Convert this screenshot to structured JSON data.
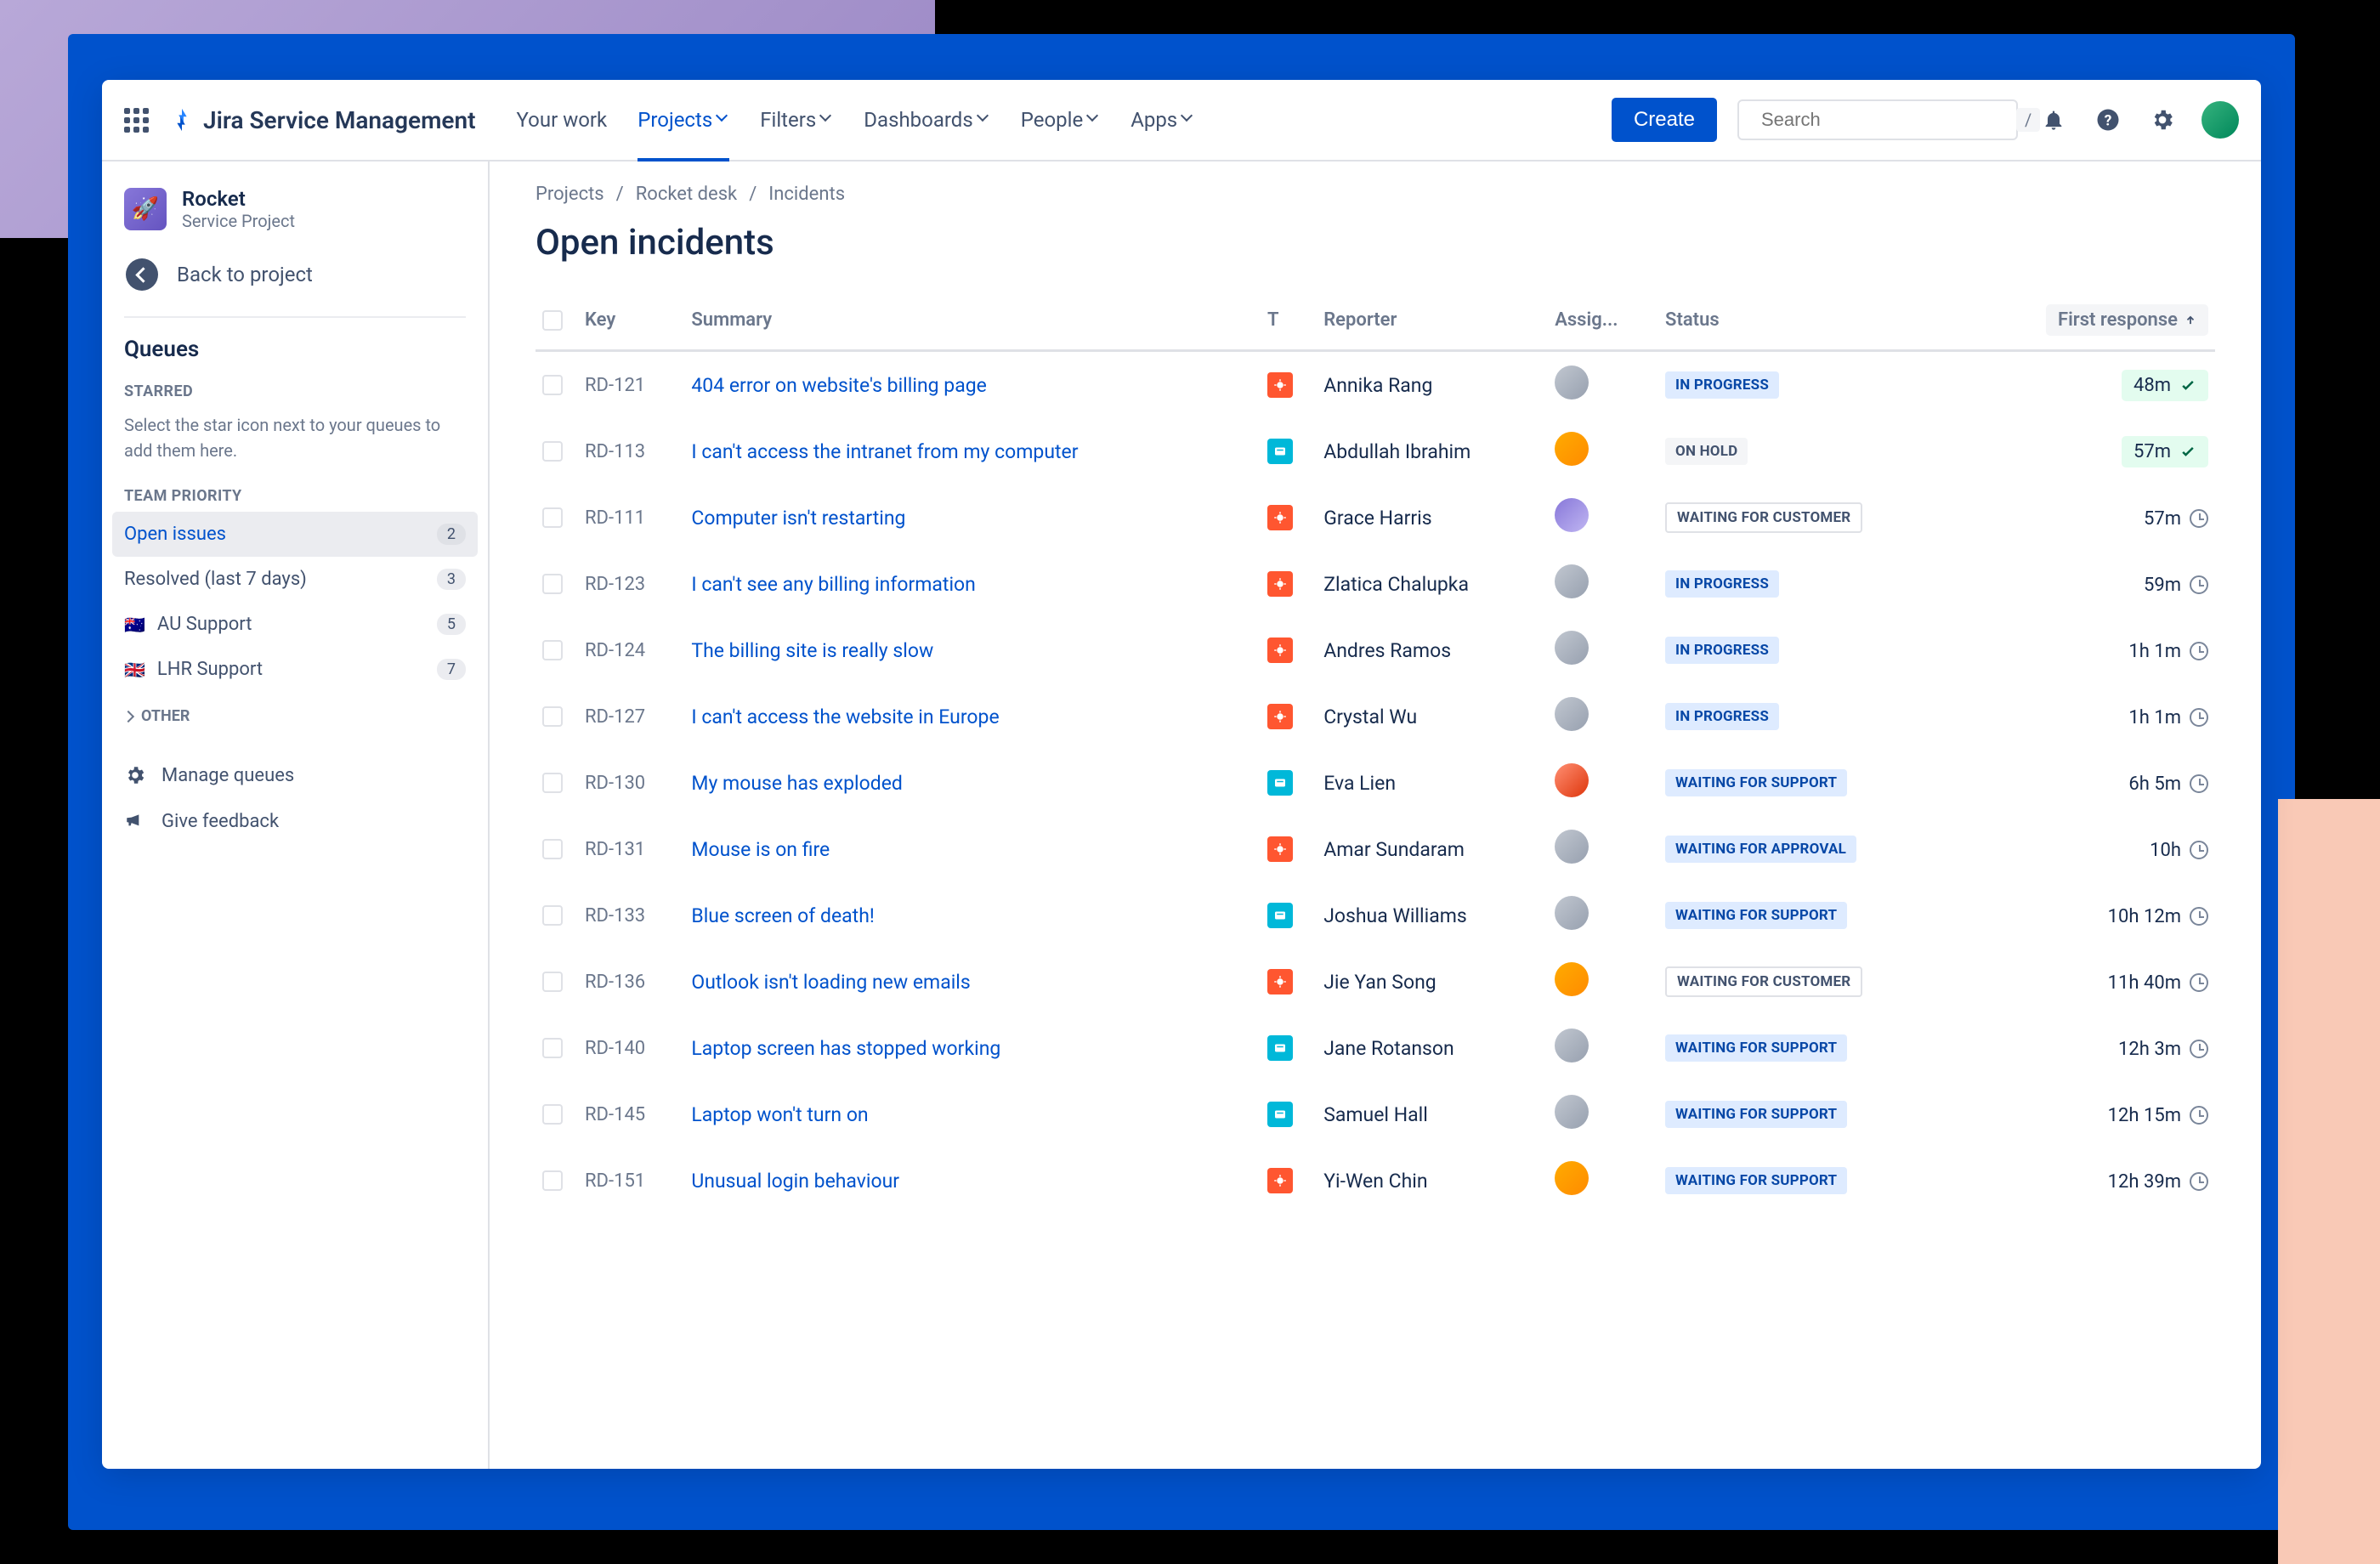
{
  "product": "Jira Service Management",
  "nav": {
    "your_work": "Your work",
    "projects": "Projects",
    "filters": "Filters",
    "dashboards": "Dashboards",
    "people": "People",
    "apps": "Apps"
  },
  "create": "Create",
  "search": {
    "placeholder": "Search",
    "kbd": "/"
  },
  "sidebar": {
    "project": {
      "name": "Rocket",
      "sub": "Service Project"
    },
    "back": "Back to project",
    "queues_title": "Queues",
    "starred": "STARRED",
    "starred_hint": "Select the star icon next to your queues to add them here.",
    "team_priority": "TEAM PRIORITY",
    "items": [
      {
        "label": "Open issues",
        "count": "2",
        "active": true
      },
      {
        "label": "Resolved (last 7 days)",
        "count": "3"
      },
      {
        "label": "AU Support",
        "count": "5",
        "flag": "🇦🇺"
      },
      {
        "label": "LHR Support",
        "count": "7",
        "flag": "🇬🇧"
      }
    ],
    "other": "OTHER",
    "manage": "Manage queues",
    "feedback": "Give feedback"
  },
  "breadcrumbs": [
    "Projects",
    "Rocket desk",
    "Incidents"
  ],
  "page_title": "Open incidents",
  "columns": {
    "key": "Key",
    "summary": "Summary",
    "type": "T",
    "reporter": "Reporter",
    "assignee": "Assig...",
    "status": "Status",
    "first_response": "First response"
  },
  "statuses": {
    "inprogress": "IN PROGRESS",
    "hold": "ON HOLD",
    "waitcust": "WAITING FOR CUSTOMER",
    "waitsup": "WAITING FOR SUPPORT",
    "waitapp": "WAITING FOR APPROVAL"
  },
  "rows": [
    {
      "key": "RD-121",
      "summary": "404 error on website's billing page",
      "type": "red",
      "reporter": "Annika Rang",
      "av": "c1",
      "status": "inprogress",
      "resp": "48m",
      "good": true
    },
    {
      "key": "RD-113",
      "summary": "I can't access the intranet from my computer",
      "type": "blue",
      "reporter": "Abdullah Ibrahim",
      "av": "c2",
      "status": "hold",
      "resp": "57m",
      "good": true
    },
    {
      "key": "RD-111",
      "summary": "Computer isn't restarting",
      "type": "red",
      "reporter": "Grace Harris",
      "av": "c3",
      "status": "waitcust",
      "resp": "57m"
    },
    {
      "key": "RD-123",
      "summary": "I can't see any billing information",
      "type": "red",
      "reporter": "Zlatica Chalupka",
      "av": "c1",
      "status": "inprogress",
      "resp": "59m"
    },
    {
      "key": "RD-124",
      "summary": "The billing site is really slow",
      "type": "red",
      "reporter": "Andres Ramos",
      "av": "c1",
      "status": "inprogress",
      "resp": "1h 1m"
    },
    {
      "key": "RD-127",
      "summary": "I can't access the website in Europe",
      "type": "red",
      "reporter": "Crystal Wu",
      "av": "c1",
      "status": "inprogress",
      "resp": "1h 1m"
    },
    {
      "key": "RD-130",
      "summary": "My mouse has exploded",
      "type": "blue",
      "reporter": "Eva Lien",
      "av": "c5",
      "status": "waitsup",
      "resp": "6h 5m"
    },
    {
      "key": "RD-131",
      "summary": "Mouse is on fire",
      "type": "red",
      "reporter": "Amar Sundaram",
      "av": "c1",
      "status": "waitapp",
      "resp": "10h"
    },
    {
      "key": "RD-133",
      "summary": "Blue screen of death!",
      "type": "blue",
      "reporter": "Joshua Williams",
      "av": "c1",
      "status": "waitsup",
      "resp": "10h 12m"
    },
    {
      "key": "RD-136",
      "summary": "Outlook isn't loading new emails",
      "type": "red",
      "reporter": "Jie Yan Song",
      "av": "c2",
      "status": "waitcust",
      "resp": "11h 40m"
    },
    {
      "key": "RD-140",
      "summary": "Laptop screen has stopped working",
      "type": "blue",
      "reporter": "Jane Rotanson",
      "av": "c1",
      "status": "waitsup",
      "resp": "12h 3m"
    },
    {
      "key": "RD-145",
      "summary": "Laptop won't turn on",
      "type": "blue",
      "reporter": "Samuel Hall",
      "av": "c1",
      "status": "waitsup",
      "resp": "12h 15m"
    },
    {
      "key": "RD-151",
      "summary": "Unusual login behaviour",
      "type": "red",
      "reporter": "Yi-Wen Chin",
      "av": "c2",
      "status": "waitsup",
      "resp": "12h 39m"
    }
  ]
}
